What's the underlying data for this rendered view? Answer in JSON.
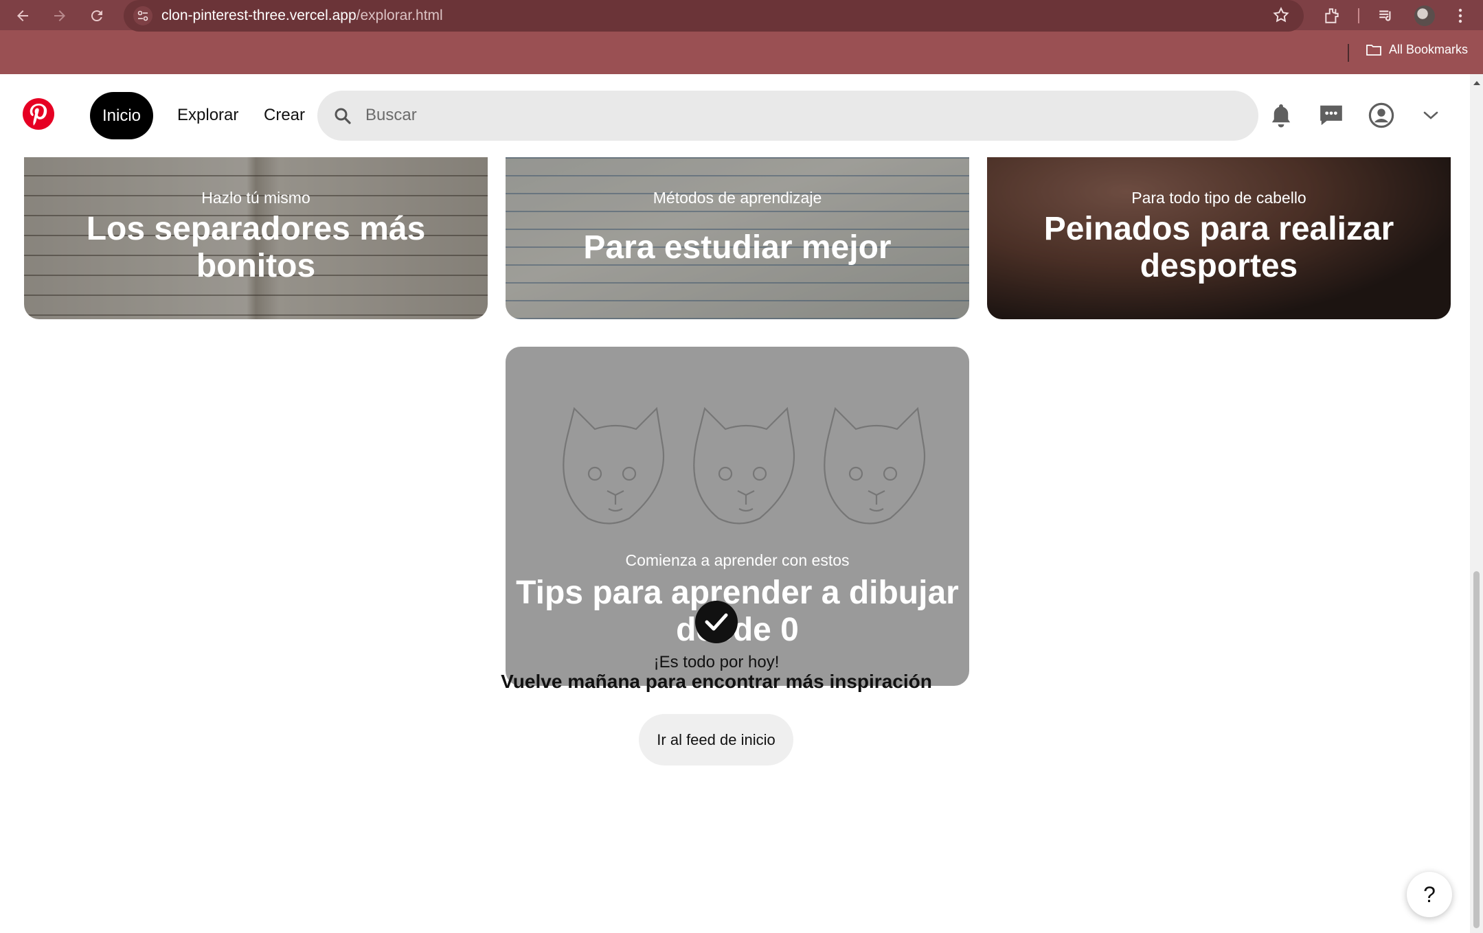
{
  "browser": {
    "url_host": "clon-pinterest-three.vercel.app",
    "url_path": "/explorar.html",
    "bookmarks_label": "All Bookmarks"
  },
  "header": {
    "nav": {
      "inicio": "Inicio",
      "explorar": "Explorar",
      "crear": "Crear"
    },
    "search_placeholder": "Buscar",
    "brand_color": "#e60023"
  },
  "cards": [
    {
      "subtitle": "Hazlo tú mismo",
      "title": "Los separadores más bonitos"
    },
    {
      "subtitle": "Métodos de aprendizaje",
      "title": "Para estudiar mejor"
    },
    {
      "subtitle": "Para todo tipo de cabello",
      "title": "Peinados para realizar desportes"
    },
    {
      "subtitle": "Comienza a aprender con estos",
      "title": "Tips para aprender a dibujar desde 0"
    }
  ],
  "end_message": {
    "subtitle": "¡Es todo por hoy!",
    "title": "Vuelve mañana para encontrar más inspiración",
    "button": "Ir al feed de inicio"
  },
  "help_label": "?"
}
